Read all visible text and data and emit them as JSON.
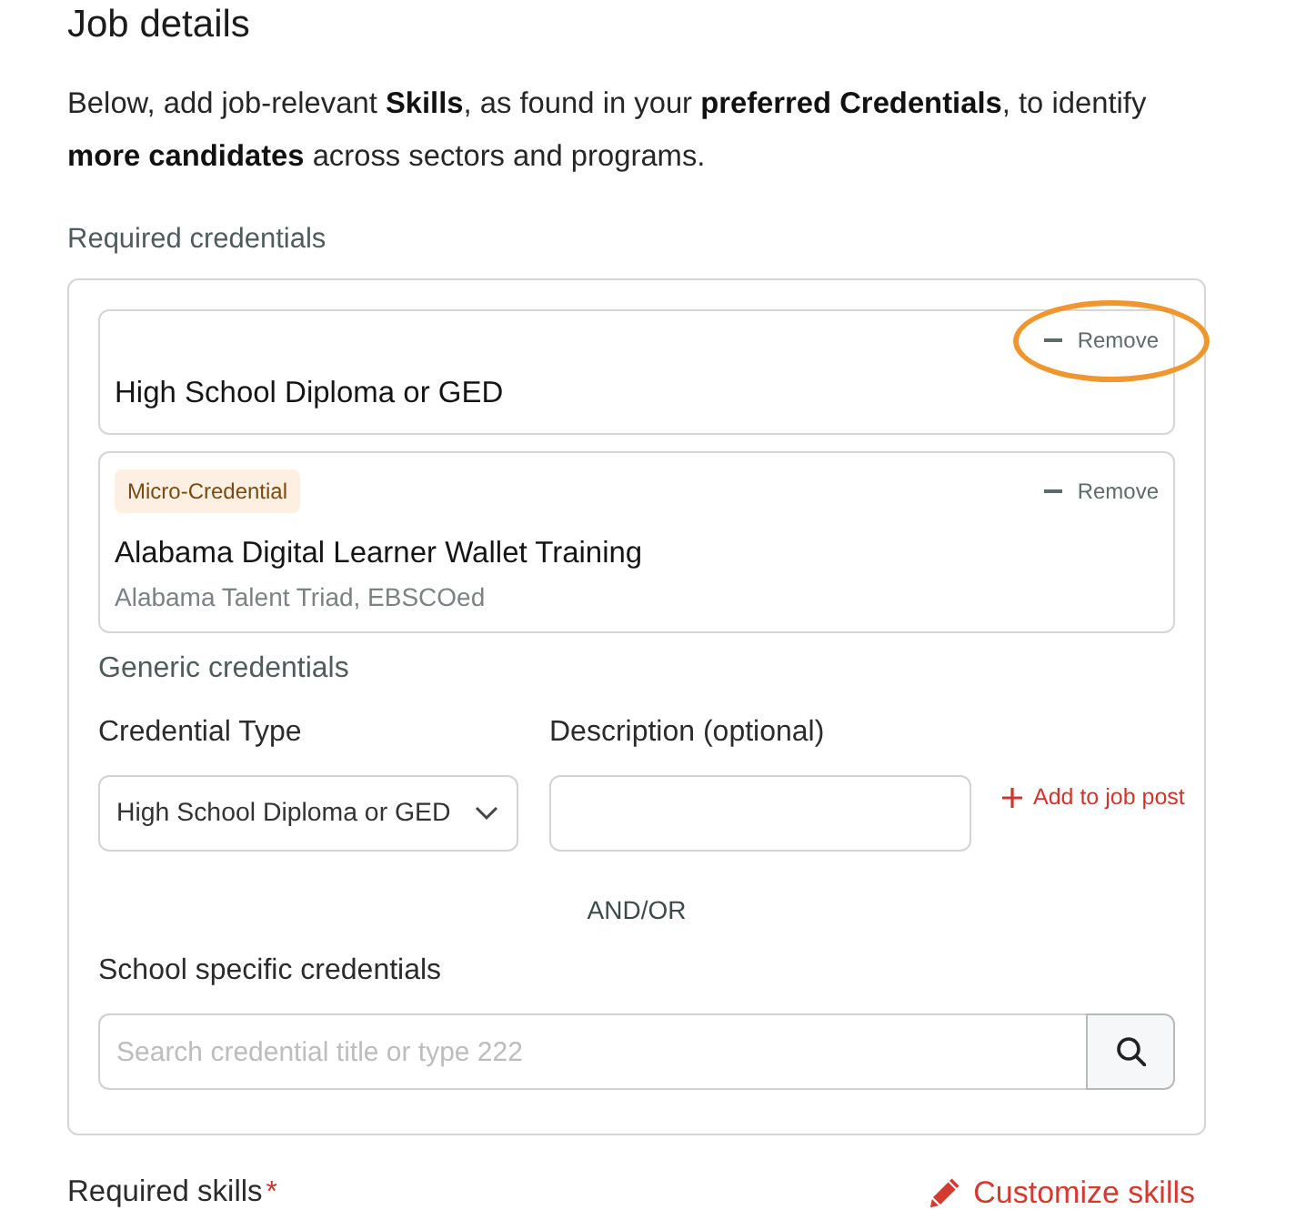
{
  "header": {
    "title": "Job details",
    "intro": "Below, add job-relevant **Skills**, as found in your **preferred Credentials**, to identify **more candidates** across sectors and programs."
  },
  "required_credentials": {
    "heading": "Required credentials",
    "items": [
      {
        "title": "High School Diploma or GED",
        "remove_label": "Remove",
        "highlighted": true
      },
      {
        "badge": "Micro-Credential",
        "title": "Alabama Digital Learner Wallet Training",
        "provider": "Alabama Talent Triad, EBSCOed",
        "remove_label": "Remove",
        "highlighted": false
      }
    ]
  },
  "generic_credentials": {
    "heading": "Generic credentials",
    "credential_type": {
      "label": "Credential Type",
      "value": "High School Diploma or GED"
    },
    "description": {
      "label": "Description (optional)"
    },
    "add_button": "Add to job post"
  },
  "separator": "AND/OR",
  "school_specific": {
    "label": "School specific credentials",
    "search": {
      "placeholder": "Search credential title or type 222"
    }
  },
  "required_skills": {
    "label": "Required skills",
    "required_mark": "*",
    "customize_button": "Customize skills"
  }
}
